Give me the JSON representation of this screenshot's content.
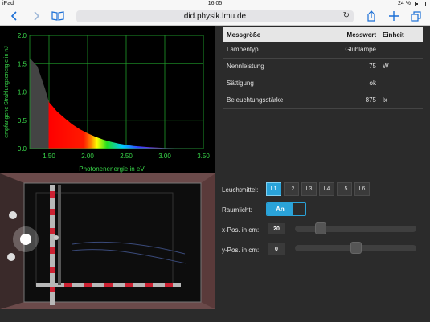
{
  "statusbar": {
    "device": "iPad",
    "time": "16:05",
    "battery": "24 %",
    "battery_level": 0.24
  },
  "browser": {
    "url": "did.physik.lmu.de"
  },
  "chart_data": {
    "type": "area",
    "title": "",
    "xlabel": "Photonenenergie in eV",
    "ylabel": "empfangene Strahlungsenergie in nJ",
    "xlim": [
      1.25,
      3.5
    ],
    "ylim": [
      0,
      2.0
    ],
    "xticks": [
      "1.50",
      "2.00",
      "2.50",
      "3.00",
      "3.50"
    ],
    "yticks": [
      "0.0",
      "0.5",
      "1.0",
      "1.5",
      "2.0"
    ],
    "grid": true,
    "x": [
      1.25,
      1.35,
      1.45,
      1.5,
      1.55,
      1.6,
      1.7,
      1.8,
      1.9,
      2.0,
      2.1,
      2.2,
      2.3,
      2.4,
      2.5,
      2.6,
      2.8,
      3.0,
      3.2,
      3.5
    ],
    "y": [
      1.6,
      1.45,
      1.05,
      0.82,
      0.74,
      0.66,
      0.54,
      0.43,
      0.34,
      0.27,
      0.21,
      0.16,
      0.12,
      0.09,
      0.065,
      0.045,
      0.025,
      0.012,
      0.005,
      0.0
    ]
  },
  "table": {
    "headers": {
      "name": "Messgröße",
      "value": "Messwert",
      "unit": "Einheit"
    },
    "rows": [
      {
        "name": "Lampentyp",
        "value": "Glühlampe",
        "unit": ""
      },
      {
        "name": "Nennleistung",
        "value": "75",
        "unit": "W"
      },
      {
        "name": "Sättigung",
        "value": "ok",
        "unit": ""
      },
      {
        "name": "Beleuchtungsstärke",
        "value": "875",
        "unit": "lx"
      }
    ]
  },
  "controls": {
    "leuchtmittel_label": "Leuchtmittel:",
    "lamps": [
      "L1",
      "L2",
      "L3",
      "L4",
      "L5",
      "L6"
    ],
    "selected_lamp": "L1",
    "raumlicht_label": "Raumlicht:",
    "raumlicht_value": "An",
    "xpos_label": "x-Pos. in cm:",
    "xpos_value": "20",
    "xpos_fraction": 0.18,
    "ypos_label": "y-Pos. in cm:",
    "ypos_value": "0",
    "ypos_fraction": 0.5
  },
  "colors": {
    "accent": "#2aa3d9",
    "grid": "#1f9a2a",
    "axis_text": "#39d84a"
  }
}
